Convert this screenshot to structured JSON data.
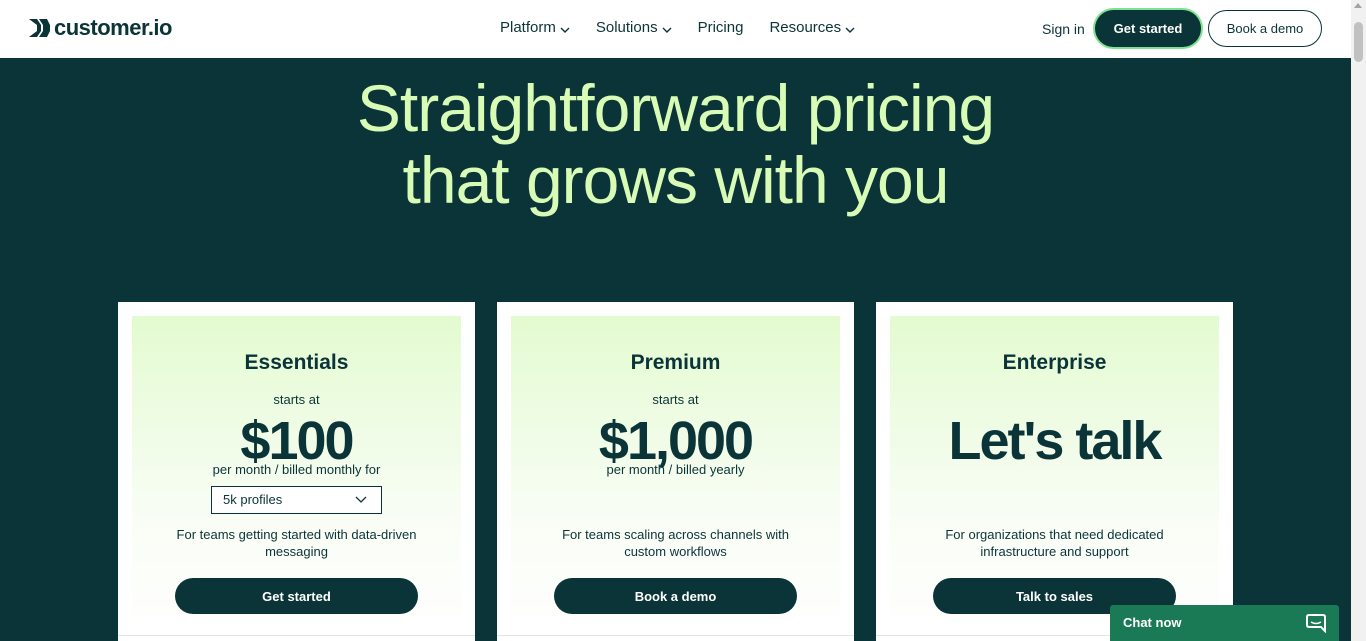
{
  "brand": {
    "name": "customer.io"
  },
  "nav": {
    "items": [
      {
        "label": "Platform",
        "has_menu": true
      },
      {
        "label": "Solutions",
        "has_menu": true
      },
      {
        "label": "Pricing",
        "has_menu": false
      },
      {
        "label": "Resources",
        "has_menu": true
      }
    ],
    "sign_in": "Sign in",
    "get_started": "Get started",
    "book_demo": "Book a demo"
  },
  "hero": {
    "line1": "Straightforward pricing",
    "line2": "that grows with you"
  },
  "plans": [
    {
      "name": "Essentials",
      "starts_at": "starts at",
      "price": "$100",
      "billing": "per month / billed monthly for",
      "select_value": "5k profiles",
      "description": "For teams getting started with data-driven messaging",
      "cta": "Get started"
    },
    {
      "name": "Premium",
      "starts_at": "starts at",
      "price": "$1,000",
      "billing": "per month / billed yearly",
      "description": "For teams scaling across channels with custom workflows",
      "cta": "Book a demo"
    },
    {
      "name": "Enterprise",
      "price": "Let's talk",
      "description": "For organizations that need dedicated infrastructure and support",
      "cta": "Talk to sales"
    }
  ],
  "chat": {
    "label": "Chat now"
  },
  "colors": {
    "dark_teal": "#0b3438",
    "hero_text": "#d8fcb5",
    "card_gradient_top": "#e3fbd0",
    "chat_green": "#1a7a55",
    "accent_ring": "#7be38f"
  }
}
